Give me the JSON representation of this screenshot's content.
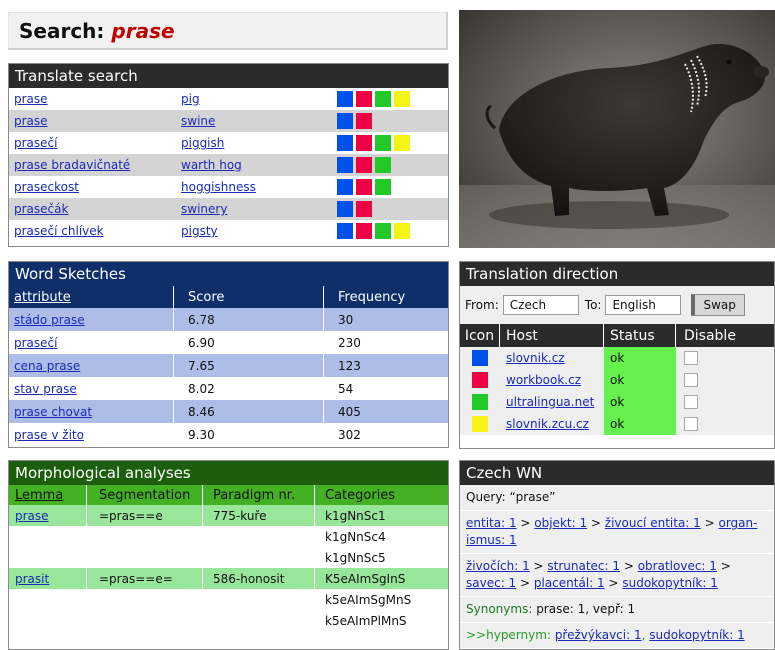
{
  "search": {
    "label": "Search:",
    "query": "prase"
  },
  "translate": {
    "title": "Translate search",
    "rows": [
      {
        "source": "prase",
        "target": "pig",
        "hosts": [
          "#0050ee",
          "#ee0044",
          "#22c828",
          "#f5f515"
        ]
      },
      {
        "source": "prase",
        "target": "swine",
        "hosts": [
          "#0050ee",
          "#ee0044"
        ]
      },
      {
        "source": "prasečí",
        "target": "piggish",
        "hosts": [
          "#0050ee",
          "#ee0044",
          "#22c828",
          "#f5f515"
        ]
      },
      {
        "source": "prase bradavičnaté",
        "target": "warth hog",
        "hosts": [
          "#0050ee",
          "#ee0044",
          "#22c828"
        ]
      },
      {
        "source": "praseckost",
        "target": "hoggishness",
        "hosts": [
          "#0050ee",
          "#ee0044",
          "#22c828"
        ]
      },
      {
        "source": "prasečák",
        "target": "swinery",
        "hosts": [
          "#0050ee",
          "#ee0044"
        ]
      },
      {
        "source": "prasečí chlívek",
        "target": "pigsty",
        "hosts": [
          "#0050ee",
          "#ee0044",
          "#22c828",
          "#f5f515"
        ]
      }
    ]
  },
  "sketches": {
    "title": "Word Sketches",
    "headers": {
      "attribute": "attribute",
      "score": "Score",
      "frequency": "Frequency"
    },
    "rows": [
      {
        "attribute": "stádo prase",
        "score": "6.78",
        "frequency": "30"
      },
      {
        "attribute": "prasečí",
        "score": "6.90",
        "frequency": "230"
      },
      {
        "attribute": "cena prase",
        "score": "7.65",
        "frequency": "123"
      },
      {
        "attribute": "stav prase",
        "score": "8.02",
        "frequency": "54"
      },
      {
        "attribute": "prase chovat",
        "score": "8.46",
        "frequency": "405"
      },
      {
        "attribute": "prase v žito",
        "score": "9.30",
        "frequency": "302"
      }
    ]
  },
  "direction": {
    "title": "Translation direction",
    "from_label": "From:",
    "from_value": "Czech",
    "to_label": "To:",
    "to_value": "English",
    "swap_label": "Swap",
    "headers": {
      "icon": "Icon",
      "host": "Host",
      "status": "Status",
      "disable": "Disable"
    },
    "hosts": [
      {
        "color": "#0050ee",
        "host": "slovnik.cz",
        "status": "ok"
      },
      {
        "color": "#ee0044",
        "host": "workbook.cz",
        "status": "ok"
      },
      {
        "color": "#22c828",
        "host": "ultralingua.net",
        "status": "ok"
      },
      {
        "color": "#f5f515",
        "host": "slovnik.zcu.cz",
        "status": "ok"
      }
    ]
  },
  "morph": {
    "title": "Morphological analyses",
    "headers": {
      "lemma": "Lemma",
      "segmentation": "Segmentation",
      "paradigm": "Paradigm nr.",
      "categories": "Categories"
    },
    "rows": [
      {
        "lemma": "prase",
        "segmentation": "=pras==e",
        "paradigm": "775-kuře",
        "category": "k1gNnSc1",
        "hl": true
      },
      {
        "lemma": "",
        "segmentation": "",
        "paradigm": "",
        "category": "k1gNnSc4",
        "hl": false
      },
      {
        "lemma": "",
        "segmentation": "",
        "paradigm": "",
        "category": "k1gNnSc5",
        "hl": false
      },
      {
        "lemma": "prasit",
        "segmentation": "=pras==e=",
        "paradigm": "586-honosit",
        "category": "K5eAImSgInS",
        "hl": true
      },
      {
        "lemma": "",
        "segmentation": "",
        "paradigm": "",
        "category": "k5eAImSgMnS",
        "hl": false
      },
      {
        "lemma": "",
        "segmentation": "",
        "paradigm": "",
        "category": "k5eAImPlMnS",
        "hl": false
      }
    ]
  },
  "wn": {
    "title": "Czech WN",
    "query_label": "Query: “prase”",
    "path1": [
      "entita: 1",
      "objekt: 1",
      "živoucí entita: 1",
      "organ- ismus: 1"
    ],
    "path2": [
      "živočích: 1",
      "strunatec: 1",
      "obratlovec: 1",
      "savec: 1",
      "placentál: 1",
      "sudokopytník: 1"
    ],
    "separator": " > ",
    "synonyms_label": "Synonyms:",
    "synonyms_value": "prase: 1, vepř: 1",
    "hypernym_label": ">>hypernym:",
    "hypernym_links": [
      "přežvýkavci: 1",
      "sudokopytník: 1"
    ]
  }
}
